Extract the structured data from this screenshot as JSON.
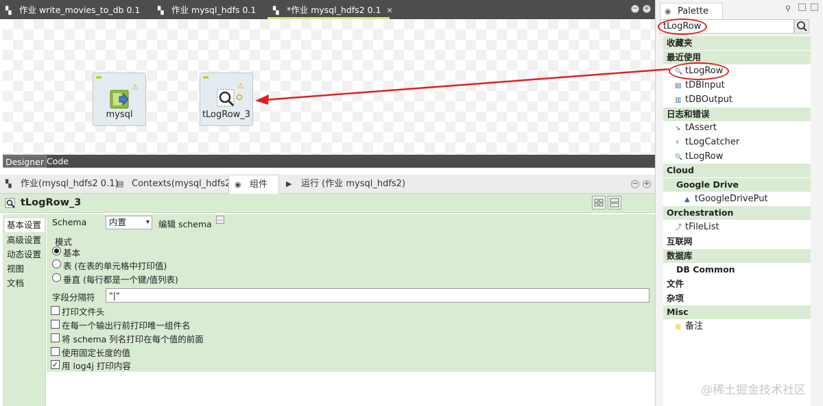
{
  "editor_tabs": [
    {
      "label": "作业 write_movies_to_db 0.1"
    },
    {
      "label": "作业 mysql_hdfs 0.1"
    },
    {
      "label": "*作业 mysql_hdfs2 0.1",
      "active": true
    }
  ],
  "canvas": {
    "components": [
      {
        "label": "mysql"
      },
      {
        "label": "tLogRow_3"
      }
    ]
  },
  "designer_tabs": {
    "designer": "Designer",
    "code": "Code"
  },
  "panel_tabs": [
    {
      "label": "作业(mysql_hdfs2 0.1)"
    },
    {
      "label": "Contexts(mysql_hdfs2)"
    },
    {
      "label": "组件",
      "active": true
    },
    {
      "label": "运行 (作业 mysql_hdfs2)"
    }
  ],
  "component_title": "tLogRow_3",
  "side_nav": [
    "基本设置",
    "高级设置",
    "动态设置",
    "视图",
    "文档"
  ],
  "settings": {
    "schema_label": "Schema",
    "schema_value": "内置",
    "edit_schema_label": "编辑 schema",
    "mode_label": "模式",
    "modes": [
      "基本",
      "表 (在表的单元格中打印值)",
      "垂直 (每行都是一个键/值列表)"
    ],
    "selected_mode": 0,
    "separator_label": "字段分隔符",
    "separator_value": "\"|\"",
    "checkboxes": [
      {
        "label": "打印文件头",
        "checked": false
      },
      {
        "label": "在每一个输出行前打印唯一组件名",
        "checked": false
      },
      {
        "label": "将 schema 列名打印在每个值的前面",
        "checked": false
      },
      {
        "label": "使用固定长度的值",
        "checked": false
      },
      {
        "label": "用 log4j 打印内容",
        "checked": true
      }
    ]
  },
  "palette": {
    "tab_label": "Palette",
    "search_value": "tLogRow",
    "rows": [
      {
        "kind": "cat",
        "label": "收藏夹"
      },
      {
        "kind": "cat",
        "label": "最近使用"
      },
      {
        "kind": "item",
        "label": "tLogRow",
        "icon": "logrow-icon"
      },
      {
        "kind": "item",
        "label": "tDBInput",
        "icon": "db-input-icon"
      },
      {
        "kind": "item",
        "label": "tDBOutput",
        "icon": "db-output-icon"
      },
      {
        "kind": "cat",
        "label": "日志和错误"
      },
      {
        "kind": "item",
        "label": "tAssert",
        "icon": "assert-icon"
      },
      {
        "kind": "item",
        "label": "tLogCatcher",
        "icon": "logcatcher-icon"
      },
      {
        "kind": "item",
        "label": "tLogRow",
        "icon": "logrow-icon"
      },
      {
        "kind": "cat",
        "label": "Cloud"
      },
      {
        "kind": "subcat",
        "label": "Google Drive"
      },
      {
        "kind": "subitem",
        "label": "tGoogleDrivePut",
        "icon": "google-drive-icon"
      },
      {
        "kind": "cat",
        "label": "Orchestration"
      },
      {
        "kind": "item",
        "label": "tFileList",
        "icon": "filelist-icon"
      },
      {
        "kind": "plaincat",
        "label": "互联网"
      },
      {
        "kind": "cat",
        "label": "数据库"
      },
      {
        "kind": "plainsub",
        "label": "DB Common"
      },
      {
        "kind": "plaincat",
        "label": "文件"
      },
      {
        "kind": "plaincat",
        "label": "杂项"
      },
      {
        "kind": "cat",
        "label": "Misc"
      },
      {
        "kind": "item",
        "label": "备注",
        "icon": "note-icon"
      }
    ]
  },
  "watermark": "@稀土掘金技术社区",
  "colors": {
    "accent_green": "#d9ebd3",
    "annotation_red": "#e02020",
    "tab_dark": "#4d4d4d"
  }
}
